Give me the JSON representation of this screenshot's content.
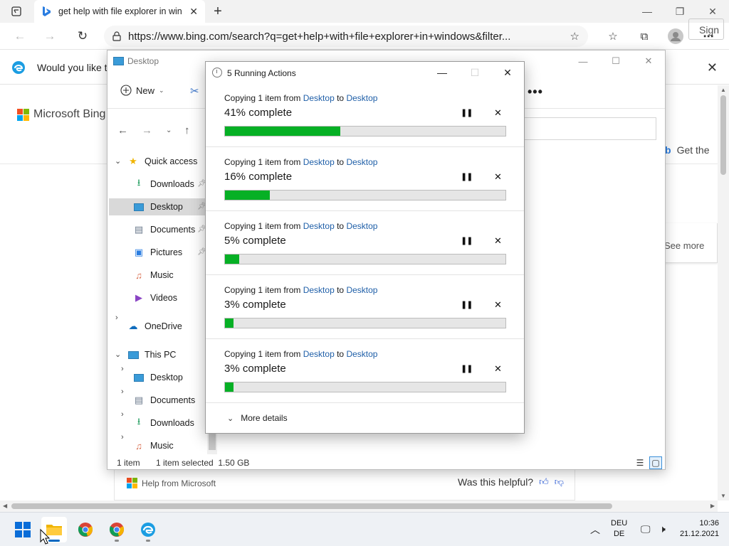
{
  "browser": {
    "tab_title": "get help with file explorer in windows",
    "tab_close": "✕",
    "new_tab": "+",
    "url": "https://www.bing.com/search?q=get+help+with+file+explorer+in+windows&filter...",
    "infobar_text": "Would you like to",
    "window_controls": {
      "minimize": "—",
      "maximize": "❐",
      "close": "✕"
    }
  },
  "bing_page": {
    "logo_text": "Microsoft Bing",
    "sign_in": "Sign",
    "get_the": "Get the",
    "see_more": "See more",
    "help_from": "Help from Microsoft",
    "was_helpful": "Was this helpful?"
  },
  "explorer": {
    "title": "Desktop",
    "new_label": "New",
    "more_label": "•••",
    "sidebar": {
      "quick_access": "Quick access",
      "downloads": "Downloads",
      "desktop": "Desktop",
      "documents": "Documents",
      "pictures": "Pictures",
      "music": "Music",
      "videos": "Videos",
      "onedrive": "OneDrive",
      "this_pc": "This PC",
      "pc_desktop": "Desktop",
      "pc_documents": "Documents",
      "pc_downloads": "Downloads",
      "pc_music": "Music"
    },
    "status": {
      "item_count": "1 item",
      "selection": "1 item selected  1.50 GB"
    }
  },
  "dialog": {
    "title": "5 Running Actions",
    "more_details": "More details",
    "desc_prefix": "Copying 1 item from",
    "desc_mid": "to",
    "operations": [
      {
        "from": "Desktop",
        "to": "Desktop",
        "percent_text": "41% complete",
        "progress": 0.41
      },
      {
        "from": "Desktop",
        "to": "Desktop",
        "percent_text": "16% complete",
        "progress": 0.16
      },
      {
        "from": "Desktop",
        "to": "Desktop",
        "percent_text": "5% complete",
        "progress": 0.05
      },
      {
        "from": "Desktop",
        "to": "Desktop",
        "percent_text": "3% complete",
        "progress": 0.03
      },
      {
        "from": "Desktop",
        "to": "Desktop",
        "percent_text": "3% complete",
        "progress": 0.03
      }
    ],
    "pause_glyph": "❚❚",
    "cancel_glyph": "✕"
  },
  "taskbar": {
    "lang_top": "DEU",
    "lang_bottom": "DE",
    "time": "10:36",
    "date": "21.12.2021"
  },
  "colors": {
    "progress_green": "#06b025",
    "link_blue": "#1f5fa8",
    "bing_red": "#f25022",
    "bing_green": "#7fba00",
    "bing_blue": "#00a4ef",
    "bing_yellow": "#ffb900"
  }
}
